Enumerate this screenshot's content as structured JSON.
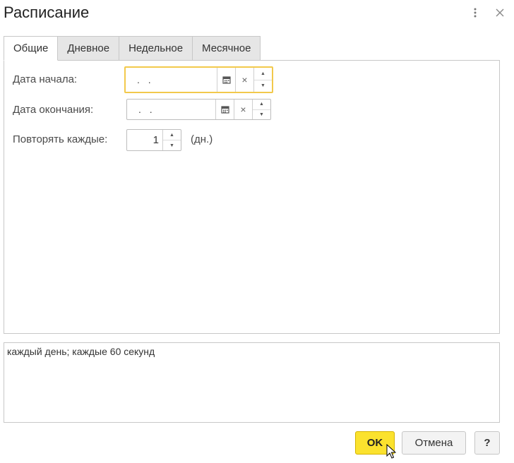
{
  "window": {
    "title": "Расписание",
    "more_icon": "more-vertical-icon",
    "close_icon": "close-icon"
  },
  "tabs": [
    {
      "label": "Общие",
      "active": true
    },
    {
      "label": "Дневное",
      "active": false
    },
    {
      "label": "Недельное",
      "active": false
    },
    {
      "label": "Месячное",
      "active": false
    }
  ],
  "general": {
    "start_date": {
      "label": "Дата начала:",
      "value": ". ."
    },
    "end_date": {
      "label": "Дата окончания:",
      "value": ". ."
    },
    "repeat": {
      "label": "Повторять каждые:",
      "value": "1",
      "unit": "(дн.)"
    }
  },
  "summary": "каждый день; каждые 60 секунд",
  "buttons": {
    "ok": "OK",
    "cancel": "Отмена",
    "help": "?"
  },
  "colors": {
    "accent_yellow": "#fbe22e",
    "focus_border": "#f2c94c"
  }
}
